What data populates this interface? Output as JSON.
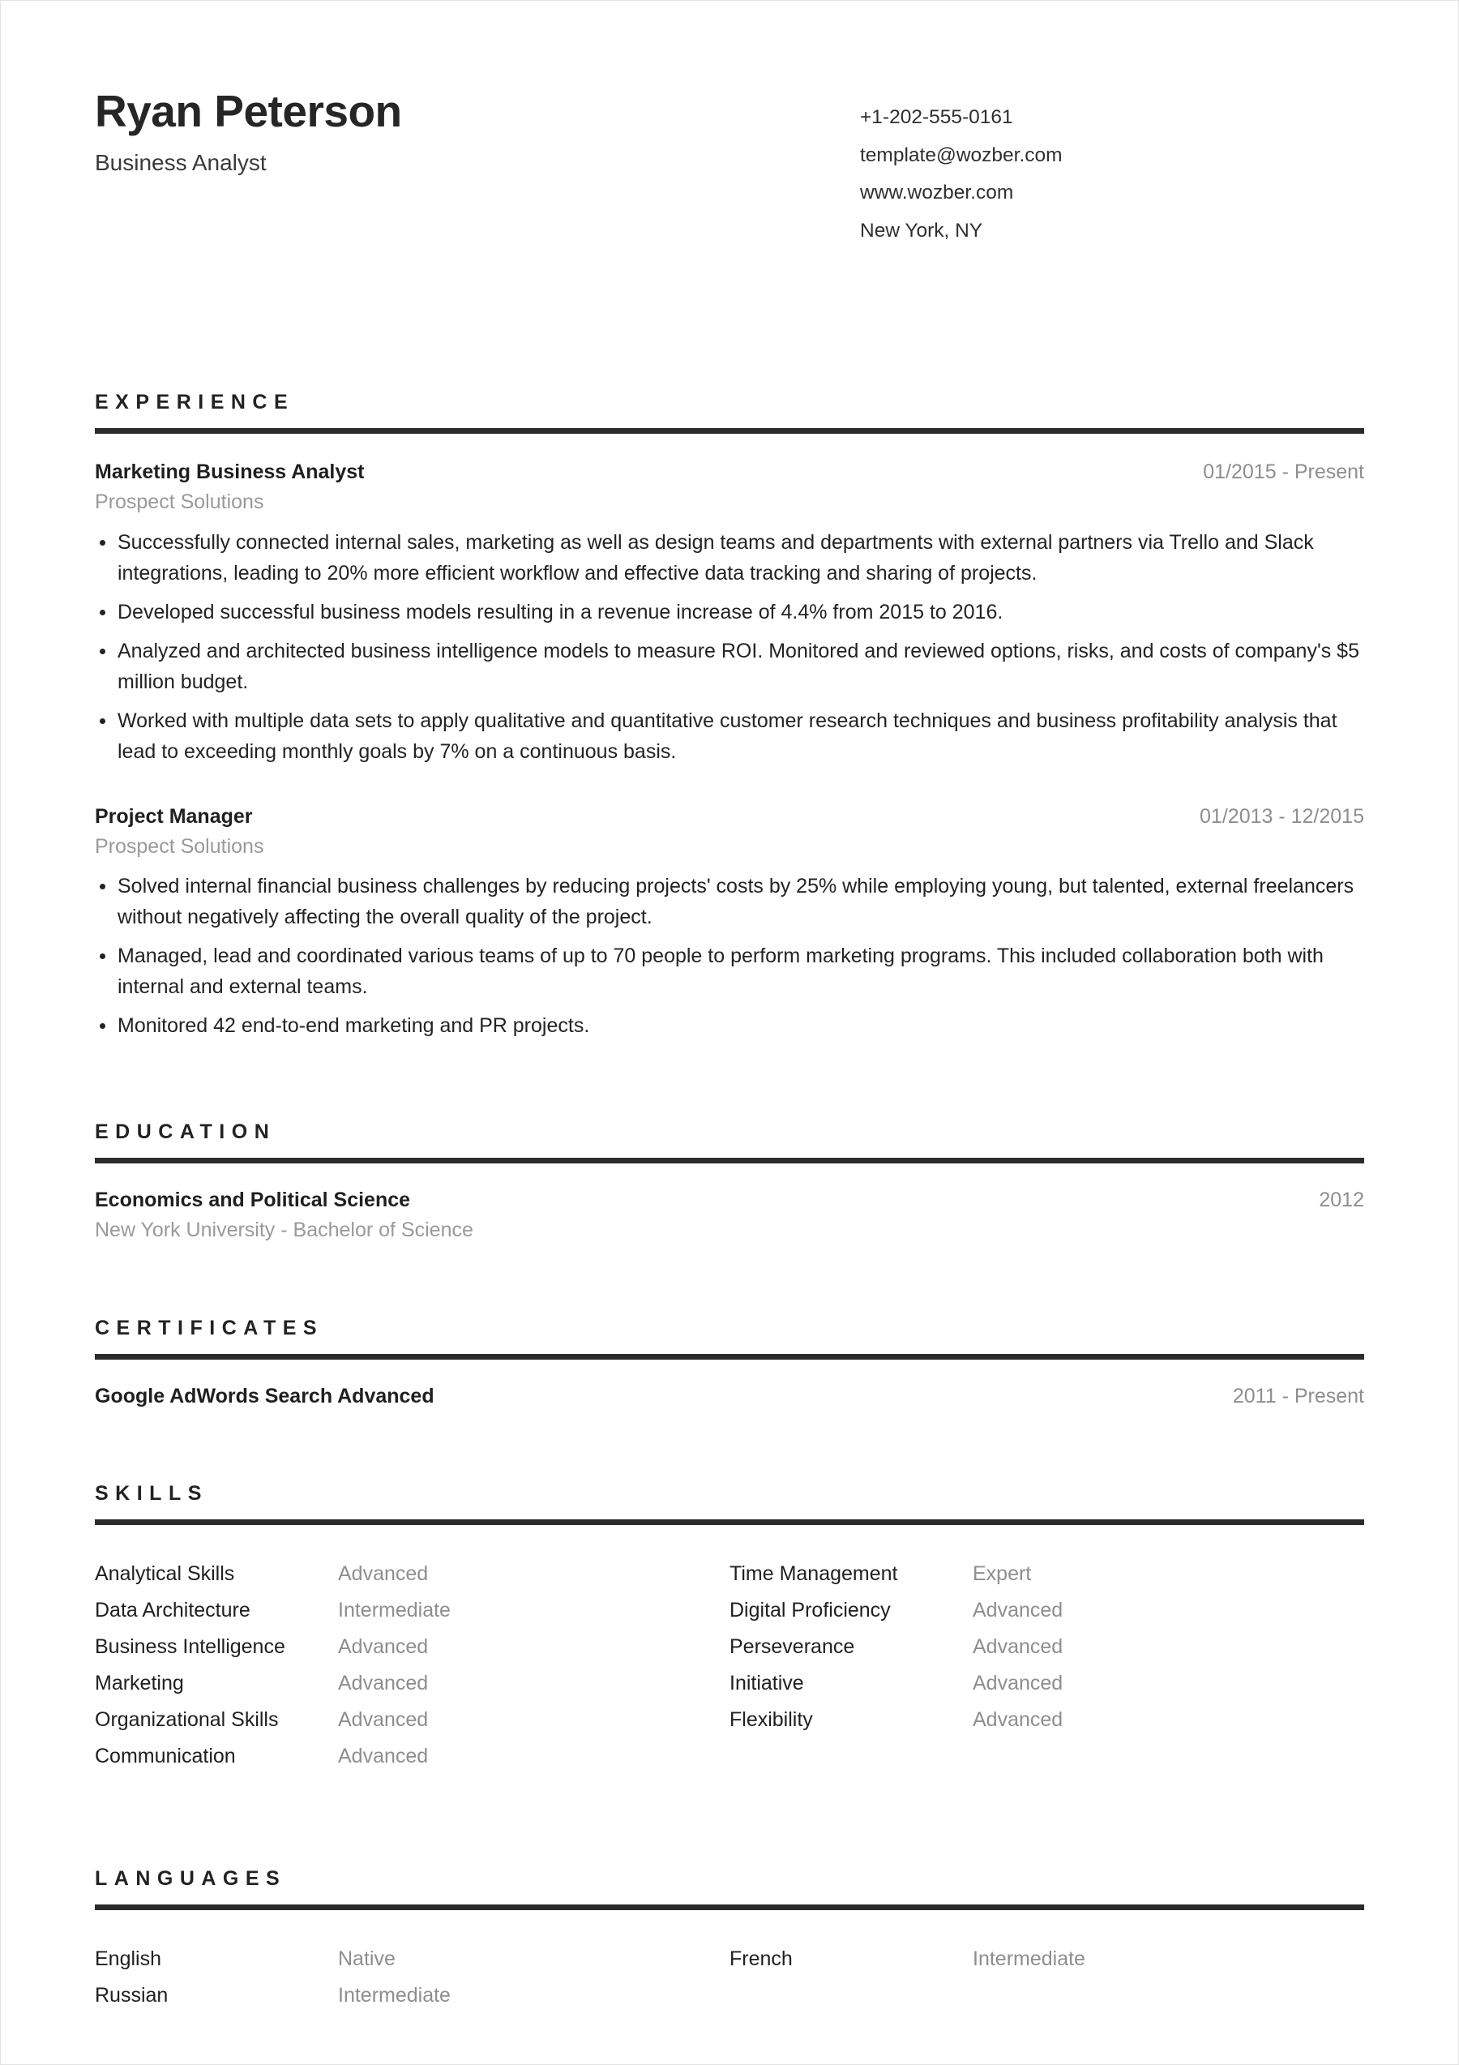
{
  "header": {
    "full_name": "Ryan Peterson",
    "job_title": "Business Analyst",
    "contact": [
      "+1-202-555-0161",
      "template@wozber.com",
      "www.wozber.com",
      "New York, NY"
    ]
  },
  "sections": {
    "experience": {
      "title": "EXPERIENCE",
      "entries": [
        {
          "title": "Marketing Business Analyst",
          "date": "01/2015 - Present",
          "company": "Prospect Solutions",
          "bullets": [
            "Successfully connected internal sales, marketing as well as design teams and departments with external partners via Trello and Slack integrations, leading to 20% more efficient workflow and effective data tracking and sharing of projects.",
            "Developed successful business models resulting in a revenue increase of 4.4% from 2015 to 2016.",
            "Analyzed and architected business intelligence models to measure ROI. Monitored and reviewed options, risks, and costs of company's $5 million budget.",
            "Worked with multiple data sets to apply qualitative and quantitative customer research techniques and business profitability analysis that lead to exceeding monthly goals by 7% on a continuous basis."
          ]
        },
        {
          "title": "Project Manager",
          "date": "01/2013 - 12/2015",
          "company": "Prospect Solutions",
          "bullets": [
            "Solved internal financial business challenges by reducing projects' costs by 25% while employing young, but talented, external freelancers without negatively affecting the overall quality of the project.",
            "Managed, lead and coordinated various teams of up to 70 people to perform marketing programs. This included collaboration both with internal and external teams.",
            "Monitored 42 end-to-end marketing and PR projects."
          ]
        }
      ]
    },
    "education": {
      "title": "EDUCATION",
      "entries": [
        {
          "title": "Economics and Political Science",
          "date": "2012",
          "institution": "New York University - Bachelor of Science"
        }
      ]
    },
    "certificates": {
      "title": "CERTIFICATES",
      "entries": [
        {
          "title": "Google AdWords Search Advanced",
          "date": "2011 - Present"
        }
      ]
    },
    "skills": {
      "title": "SKILLS",
      "left": [
        {
          "name": "Analytical Skills",
          "level": "Advanced"
        },
        {
          "name": "Data Architecture",
          "level": "Intermediate"
        },
        {
          "name": "Business Intelligence",
          "level": "Advanced"
        },
        {
          "name": "Marketing",
          "level": "Advanced"
        },
        {
          "name": "Organizational Skills",
          "level": "Advanced"
        },
        {
          "name": "Communication",
          "level": "Advanced"
        }
      ],
      "right": [
        {
          "name": "Time Management",
          "level": "Expert"
        },
        {
          "name": "Digital Proficiency",
          "level": "Advanced"
        },
        {
          "name": "Perseverance",
          "level": "Advanced"
        },
        {
          "name": "Initiative",
          "level": "Advanced"
        },
        {
          "name": "Flexibility",
          "level": "Advanced"
        }
      ]
    },
    "languages": {
      "title": "LANGUAGES",
      "left": [
        {
          "name": "English",
          "level": "Native"
        },
        {
          "name": "Russian",
          "level": "Intermediate"
        }
      ],
      "right": [
        {
          "name": "French",
          "level": "Intermediate"
        }
      ]
    }
  },
  "colors": {
    "text": "#232323",
    "muted": "#8e8e8e",
    "rule": "#2b2b2b"
  }
}
